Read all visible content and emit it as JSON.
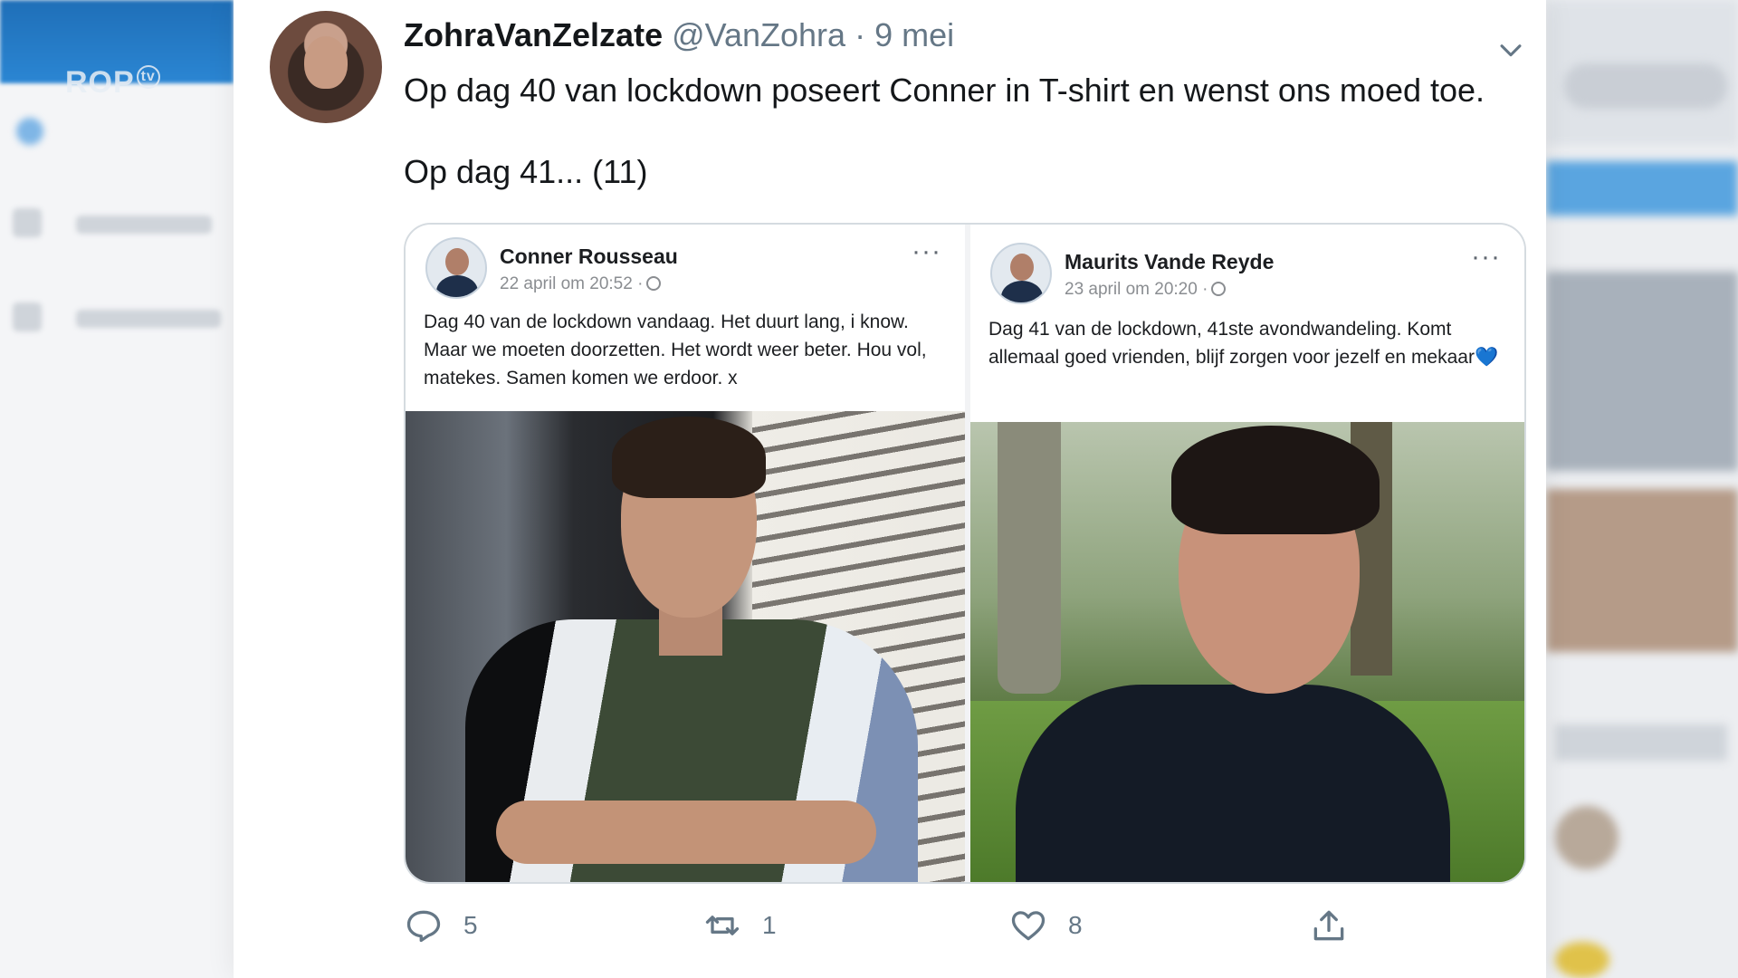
{
  "channel": {
    "logo": "ROP",
    "badge": "tv"
  },
  "tweet": {
    "display_name": "ZohraVanZelzate",
    "handle": "@VanZohra",
    "separator": "·",
    "date": "9 mei",
    "paragraphs": [
      "Op dag 40 van lockdown poseert Conner in T-shirt en wenst ons moed toe.",
      "Op dag 41... (11)"
    ],
    "actions": {
      "reply_count": "5",
      "retweet_count": "1",
      "like_count": "8"
    }
  },
  "embedded_posts": [
    {
      "name": "Conner Rousseau",
      "time": "22 april om 20:52 ·",
      "text": "Dag 40 van de lockdown vandaag. Het duurt lang, i know. Maar we moeten doorzetten. Het wordt weer beter. Hou vol, matekes. Samen komen we erdoor. x"
    },
    {
      "name": "Maurits Vande Reyde",
      "time": "23 april om 20:20 ·",
      "text": "Dag 41 van de lockdown, 41ste avondwandeling. Komt allemaal goed vrienden, blijf zorgen voor jezelf en mekaar",
      "emoji": "💙"
    }
  ],
  "more_icon": "···",
  "colors": {
    "accent": "#1da1f2",
    "muted": "#657786",
    "border": "#d5dbe0"
  }
}
